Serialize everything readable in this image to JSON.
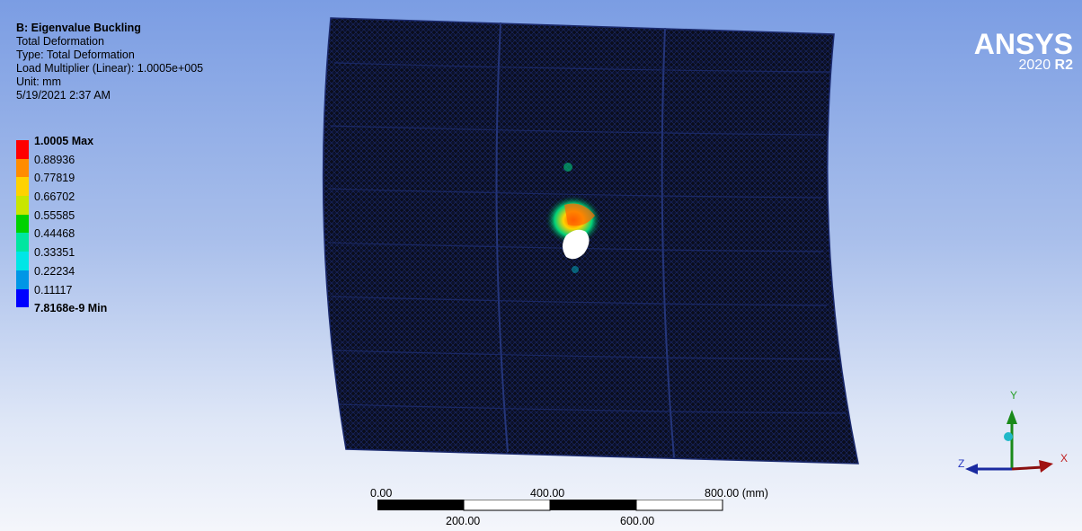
{
  "info": {
    "title": "B: Eigenvalue Buckling",
    "result": "Total Deformation",
    "type": "Type: Total Deformation",
    "load_multiplier": "Load Multiplier (Linear): 1.0005e+005",
    "unit": "Unit: mm",
    "timestamp": "5/19/2021 2:37 AM"
  },
  "legend": {
    "max_label": "1.0005 Max",
    "min_label": "7.8168e-9 Min",
    "labels": [
      "0.88936",
      "0.77819",
      "0.66702",
      "0.55585",
      "0.44468",
      "0.33351",
      "0.22234",
      "0.11117"
    ],
    "colors": [
      "#ff0000",
      "#ff8c00",
      "#ffd200",
      "#c8e600",
      "#00d200",
      "#00e6a0",
      "#00e6e6",
      "#0096e6",
      "#0000ff"
    ]
  },
  "logo": {
    "brand": "ANSYS",
    "version": "2020",
    "release": "R2"
  },
  "scale_bar": {
    "top_labels": [
      "0.00",
      "400.00",
      "800.00 (mm)"
    ],
    "bottom_labels": [
      "200.00",
      "600.00"
    ]
  },
  "triad": {
    "x": "X",
    "y": "Y",
    "z": "Z"
  }
}
